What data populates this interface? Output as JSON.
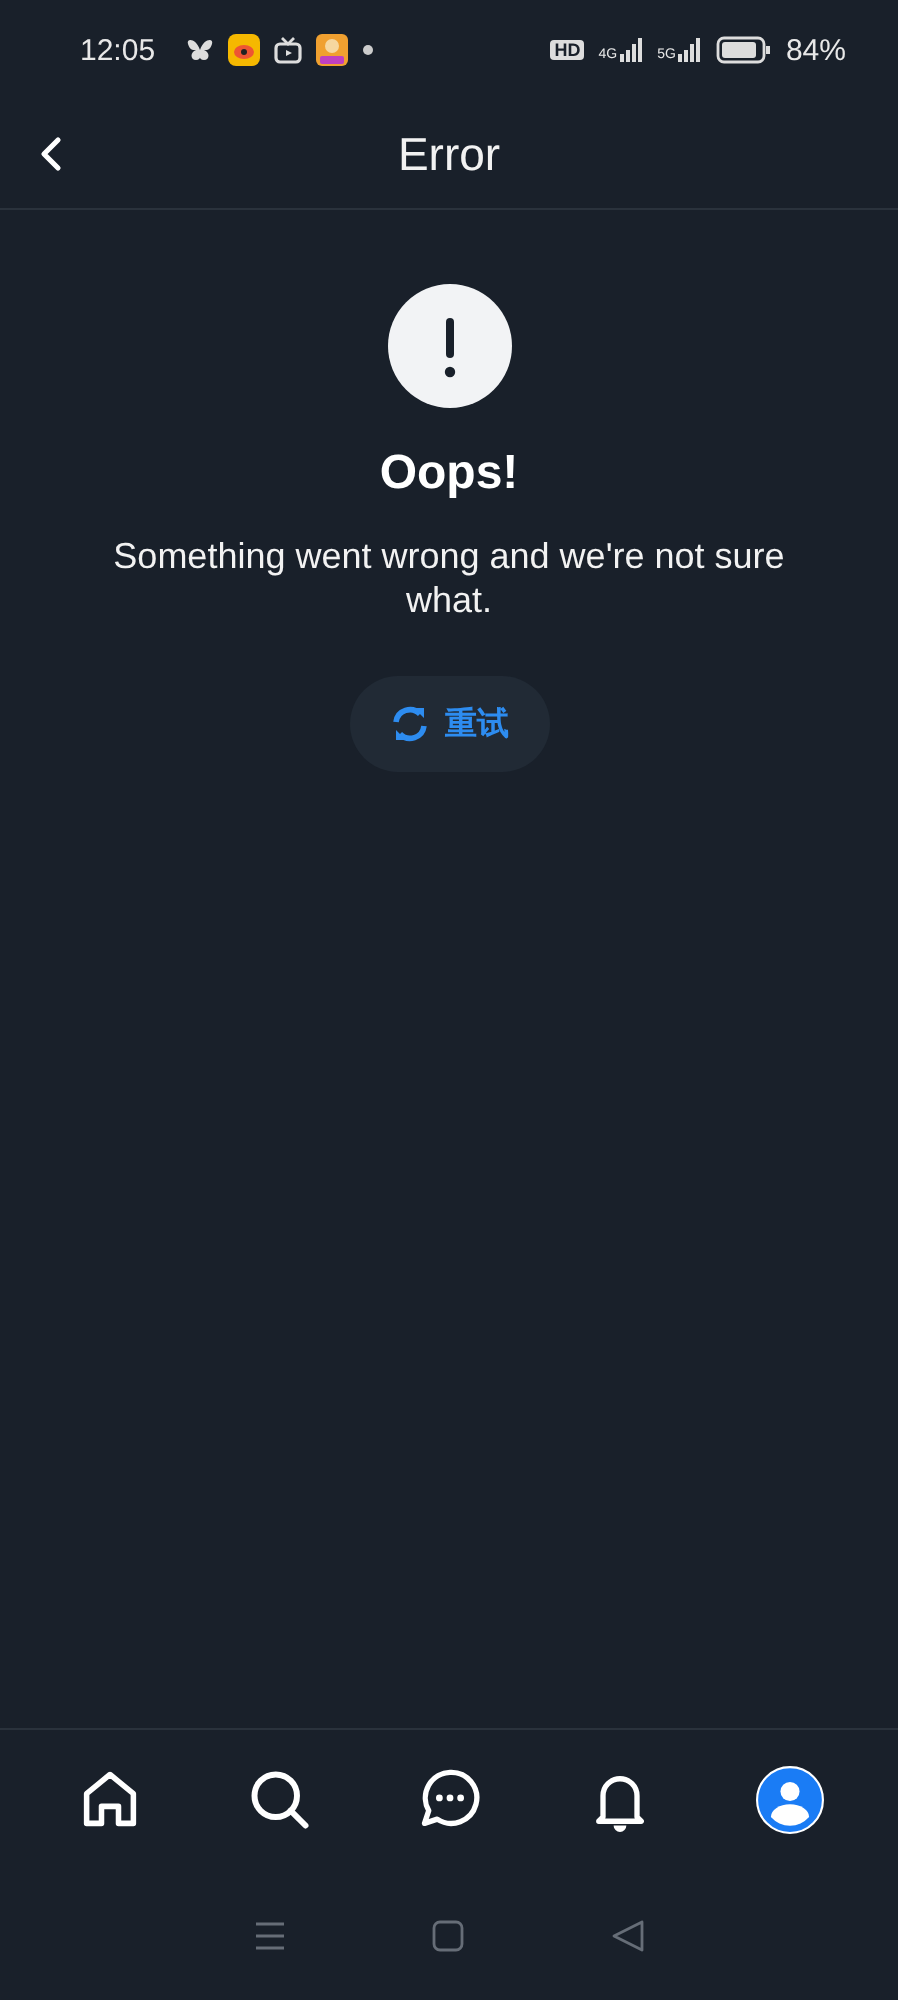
{
  "status_bar": {
    "time": "12:05",
    "hd": "HD",
    "network_1": "4G",
    "network_2": "5G",
    "battery": "84%"
  },
  "header": {
    "title": "Error"
  },
  "error": {
    "title": "Oops!",
    "message": "Something went wrong and we're not sure what.",
    "retry_button": "重试"
  },
  "bottom_nav": [
    {
      "kind": "home"
    },
    {
      "kind": "search"
    },
    {
      "kind": "chat"
    },
    {
      "kind": "bell"
    },
    {
      "kind": "profile"
    }
  ]
}
